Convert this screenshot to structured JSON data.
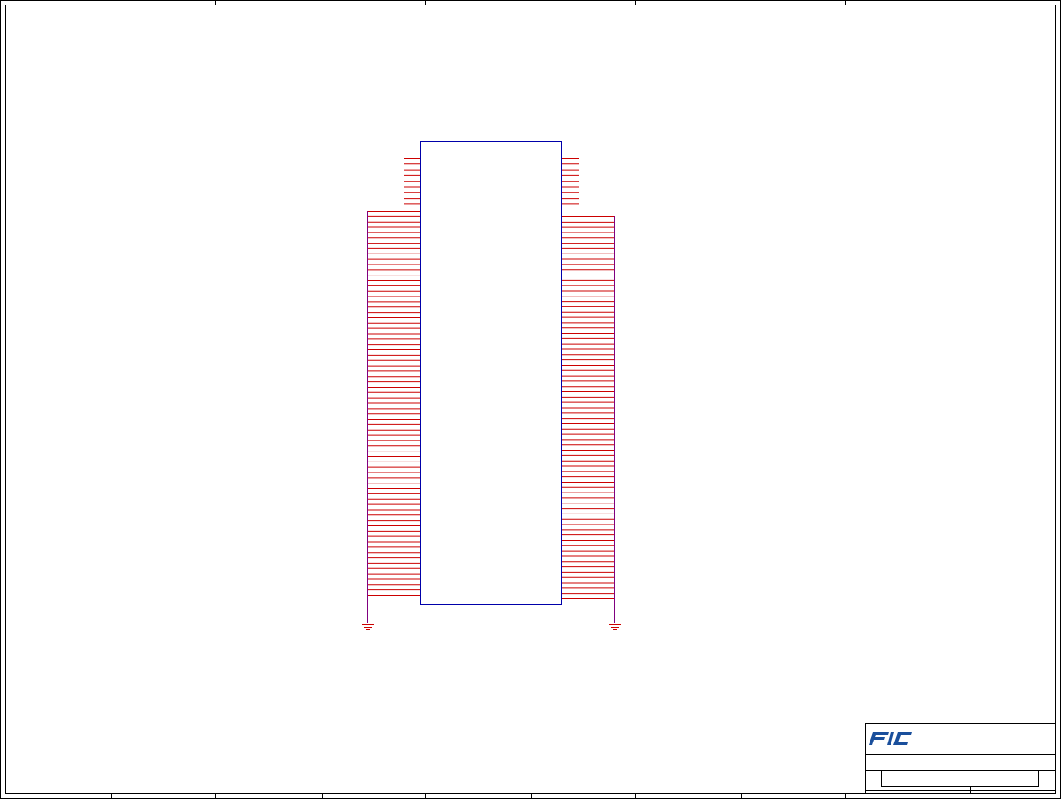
{
  "sheet": {
    "border_color": "#000000",
    "background": "#ffffff"
  },
  "component": {
    "body_color": "#0000aa",
    "pin_color": "#cc0000",
    "bus_color": "#800080",
    "left_top_pin_count": 9,
    "right_top_pin_count": 9,
    "left_pin_count": 73,
    "right_pin_count": 73
  },
  "ground_symbols": [
    {
      "side": "left",
      "icon": "ground-icon"
    },
    {
      "side": "right",
      "icon": "ground-icon"
    }
  ],
  "title_block": {
    "logo": {
      "text": "FIC",
      "color": "#1a4f9c",
      "icon": "fic-logo-icon"
    },
    "title": "",
    "doc_number": "",
    "revision": ""
  }
}
